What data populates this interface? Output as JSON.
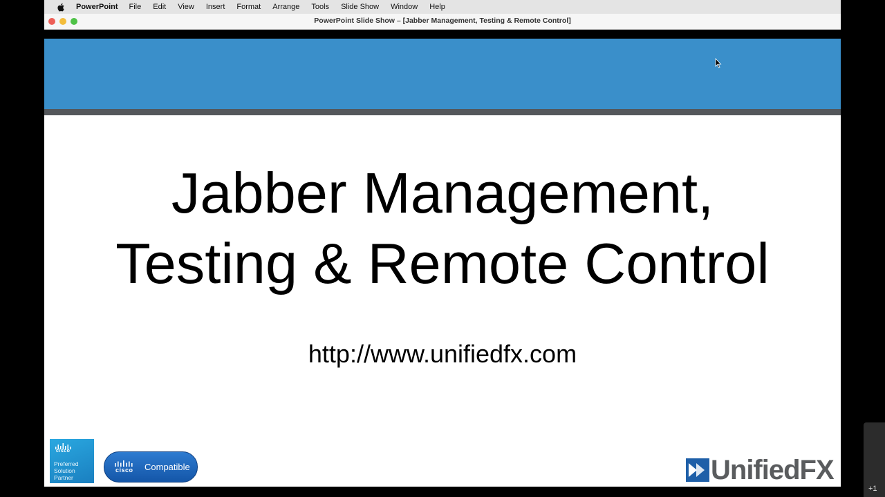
{
  "menubar": {
    "app_name": "PowerPoint",
    "items": [
      "File",
      "Edit",
      "View",
      "Insert",
      "Format",
      "Arrange",
      "Tools",
      "Slide Show",
      "Window",
      "Help"
    ]
  },
  "window": {
    "title": "PowerPoint Slide Show – [Jabber Management, Testing & Remote Control]"
  },
  "slide": {
    "title_line1": "Jabber Management,",
    "title_line2": "Testing & Remote Control",
    "url": "http://www.unifiedfx.com",
    "band_color": "#3a8fca",
    "badges": {
      "partner_brand": "cisco",
      "partner_lines": [
        "Preferred",
        "Solution",
        "Partner"
      ],
      "compatible_brand": "cisco",
      "compatible_label": "Compatible"
    },
    "logo_text": "UnifiedFX"
  },
  "side_widget": {
    "label": "+1"
  },
  "icons": [
    "apple-icon",
    "cursor-icon",
    "cisco-bars-icon",
    "unifiedfx-mark-icon"
  ]
}
